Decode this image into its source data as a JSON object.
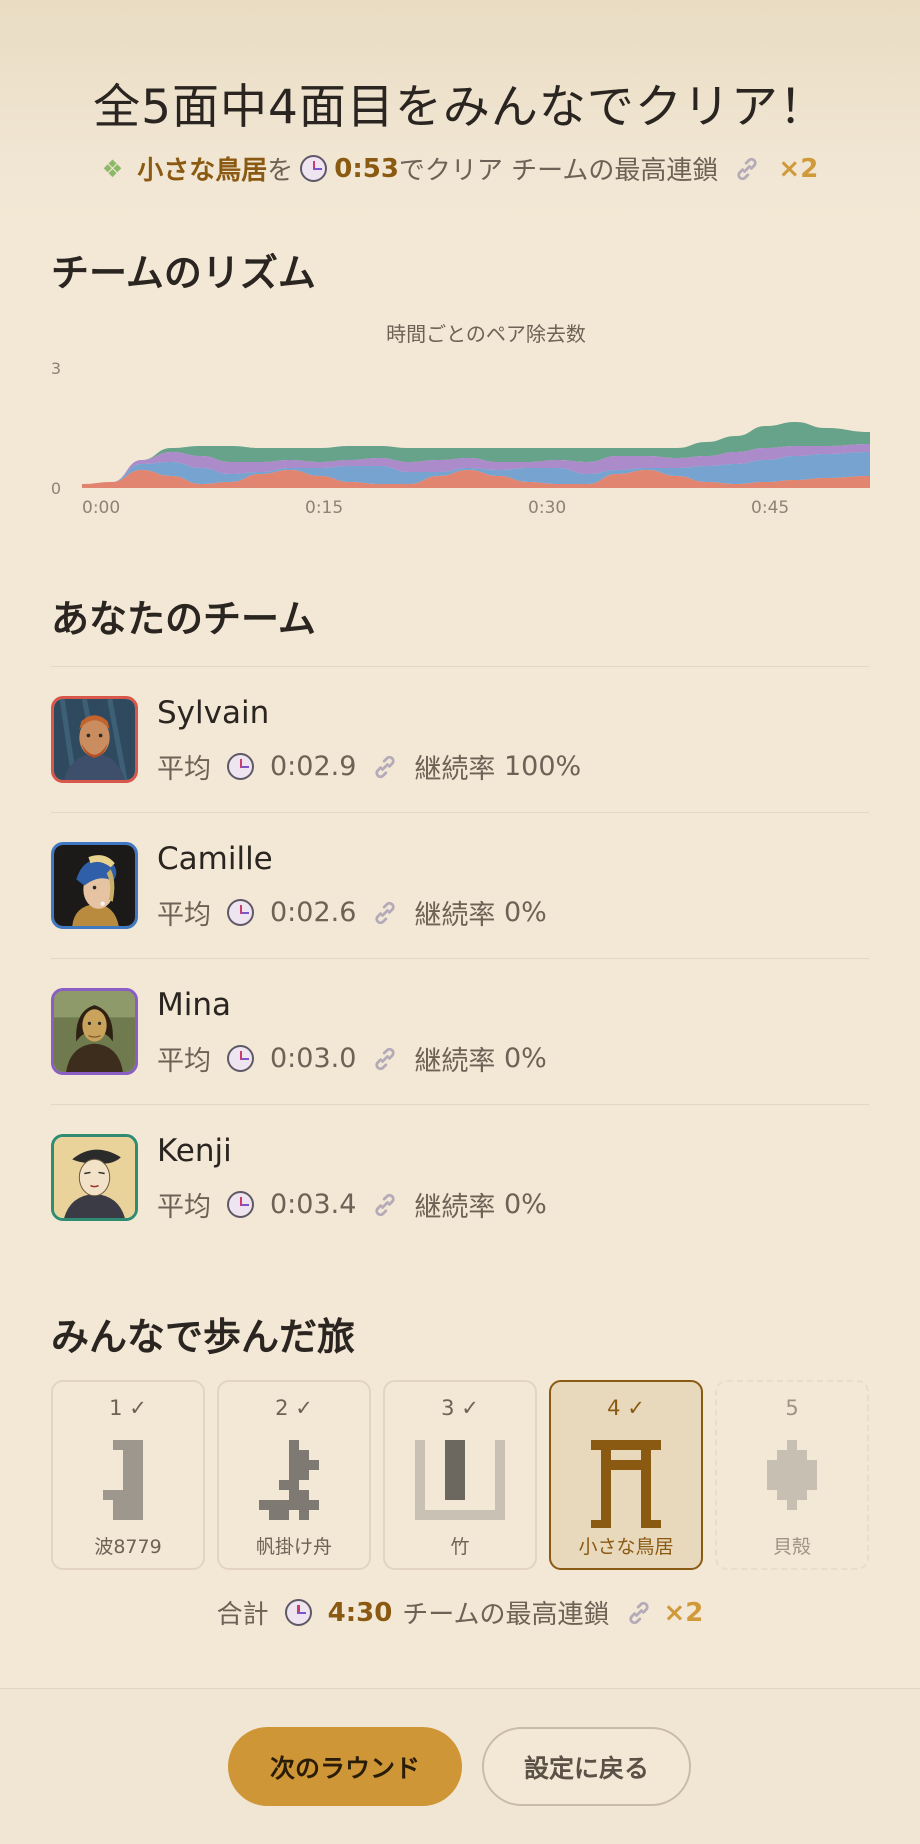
{
  "header": {
    "title": "全5面中4面目をみんなでクリア！",
    "summary": {
      "puzzle_name": "小さな鳥居",
      "particle": "を",
      "time": "0:53",
      "suffix": "でクリア チームの最高連鎖",
      "chain": "×2"
    }
  },
  "rhythm": {
    "title": "チームのリズム",
    "chart_data": {
      "type": "area",
      "stacked": true,
      "title": "時間ごとのペア除去数",
      "xlabel": "",
      "ylabel": "",
      "x_ticks": [
        "0:00",
        "0:15",
        "0:30",
        "0:45"
      ],
      "y_ticks": [
        "0",
        "3"
      ],
      "xlim": [
        0,
        53
      ],
      "ylim": [
        0,
        3
      ],
      "grid": false,
      "x": [
        0,
        2,
        4,
        6,
        8,
        10,
        12,
        14,
        16,
        18,
        20,
        22,
        24,
        26,
        28,
        30,
        32,
        34,
        36,
        38,
        40,
        42,
        44,
        46,
        48,
        50,
        53
      ],
      "series": [
        {
          "color": "#e0806a",
          "values": [
            0.1,
            0.15,
            0.45,
            0.3,
            0.1,
            0.15,
            0.35,
            0.45,
            0.3,
            0.15,
            0.1,
            0.1,
            0.3,
            0.45,
            0.3,
            0.15,
            0.1,
            0.1,
            0.35,
            0.45,
            0.3,
            0.15,
            0.1,
            0.15,
            0.2,
            0.25,
            0.3
          ]
        },
        {
          "color": "#6f9fd0",
          "values": [
            0.0,
            0.0,
            0.15,
            0.35,
            0.4,
            0.2,
            0.05,
            0.05,
            0.2,
            0.4,
            0.45,
            0.3,
            0.1,
            0.05,
            0.15,
            0.35,
            0.4,
            0.25,
            0.1,
            0.05,
            0.2,
            0.4,
            0.5,
            0.55,
            0.6,
            0.6,
            0.6
          ]
        },
        {
          "color": "#a786c9",
          "values": [
            0.0,
            0.0,
            0.1,
            0.25,
            0.3,
            0.3,
            0.25,
            0.2,
            0.15,
            0.15,
            0.2,
            0.25,
            0.3,
            0.25,
            0.2,
            0.15,
            0.2,
            0.3,
            0.35,
            0.3,
            0.25,
            0.25,
            0.3,
            0.3,
            0.25,
            0.2,
            0.2
          ]
        },
        {
          "color": "#5f9e86",
          "values": [
            0.0,
            0.0,
            0.0,
            0.1,
            0.25,
            0.4,
            0.35,
            0.3,
            0.35,
            0.35,
            0.3,
            0.35,
            0.3,
            0.25,
            0.35,
            0.35,
            0.3,
            0.35,
            0.2,
            0.2,
            0.25,
            0.35,
            0.4,
            0.55,
            0.6,
            0.45,
            0.3
          ]
        }
      ]
    }
  },
  "team": {
    "title": "あなたのチーム",
    "avg_label": "平均",
    "streak_label": "継続率",
    "players": [
      {
        "name": "Sylvain",
        "avg": "0:02.9",
        "streak": "100%",
        "color": "#d9574a",
        "portrait": "van-gogh-portrait"
      },
      {
        "name": "Camille",
        "avg": "0:02.6",
        "streak": "0%",
        "color": "#3f79c4",
        "portrait": "pearl-earring-portrait"
      },
      {
        "name": "Mina",
        "avg": "0:03.0",
        "streak": "0%",
        "color": "#8a5ec4",
        "portrait": "mona-lisa-portrait"
      },
      {
        "name": "Kenji",
        "avg": "0:03.4",
        "streak": "0%",
        "color": "#2f8c73",
        "portrait": "ukiyoe-portrait"
      }
    ]
  },
  "journey": {
    "title": "みんなで歩んだ旅",
    "stages": [
      {
        "num": "1 ✓",
        "name": "波8779",
        "state": "done"
      },
      {
        "num": "2 ✓",
        "name": "帆掛け舟",
        "state": "done"
      },
      {
        "num": "3 ✓",
        "name": "竹",
        "state": "done"
      },
      {
        "num": "4 ✓",
        "name": "小さな鳥居",
        "state": "current"
      },
      {
        "num": "5",
        "name": "貝殻",
        "state": "locked"
      }
    ]
  },
  "total": {
    "label": "合計",
    "time": "4:30",
    "chain_label": "チームの最高連鎖",
    "chain": "×2"
  },
  "buttons": {
    "next": "次のラウンド",
    "back": "設定に戻る"
  }
}
